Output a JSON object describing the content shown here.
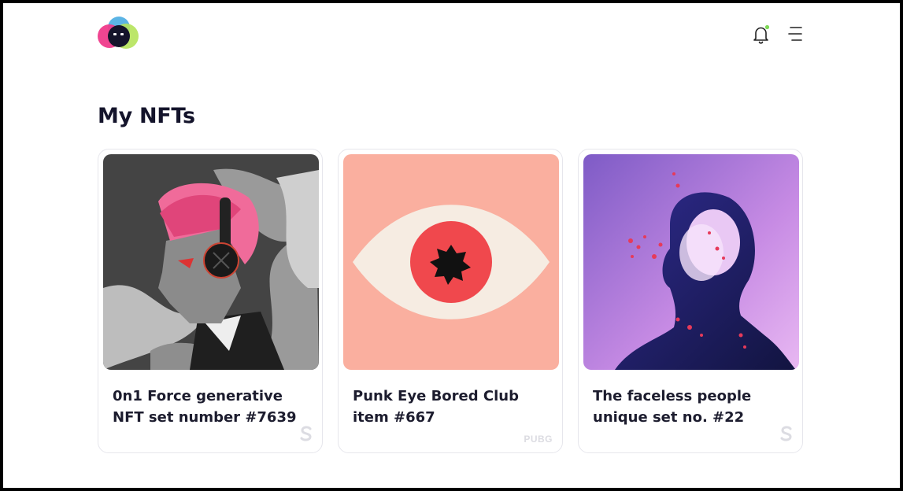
{
  "page": {
    "title": "My NFTs"
  },
  "header": {
    "logo_icon": "app-logo-icon",
    "notification_icon": "bell-icon",
    "menu_icon": "hamburger-menu-icon",
    "notification_dot_color": "#7ed957"
  },
  "cards": [
    {
      "name": "0n1 Force generative NFT set number #7639",
      "brand_icon": "s-brand-icon",
      "brand_text": ""
    },
    {
      "name": "Punk Eye Bored Club item #667",
      "brand_icon": "pubg-brand-icon",
      "brand_text": "PUBG"
    },
    {
      "name": "The faceless people unique set no. #22",
      "brand_icon": "s-brand-icon",
      "brand_text": ""
    }
  ],
  "colors": {
    "title": "#14142b",
    "card_border": "#e6e6ec",
    "accent_pink": "#ef3b8b",
    "accent_green": "#b5e35a",
    "accent_blue": "#3ea7e0"
  }
}
